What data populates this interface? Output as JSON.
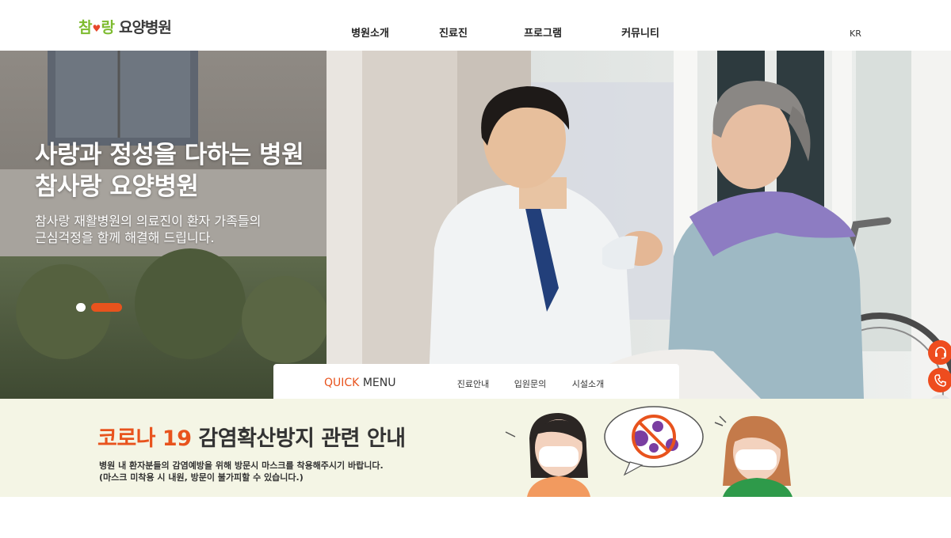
{
  "header": {
    "logo_part1": "참",
    "logo_part2": "랑",
    "logo_part3": "요양병원",
    "nav": [
      "병원소개",
      "진료진",
      "프로그램",
      "커뮤니티"
    ],
    "lang": "KR"
  },
  "hero": {
    "title_line1": "사랑과 정성을 다하는 병원",
    "title_line2": "참사랑 요양병원",
    "sub_line1": "참사랑 재활병원의 의료진이 환자 가족들의",
    "sub_line2": "근심걱정을 함께 해결해 드립니다."
  },
  "quick": {
    "title_accent": "QUICK",
    "title_rest": "MENU",
    "links": [
      "진료안내",
      "입원문의",
      "시설소개"
    ]
  },
  "banner": {
    "title_accent": "코로나 19",
    "title_rest": "감염확산방지 관련 안내",
    "line1": "병원 내 환자분들의 감염예방을 위해 방문시 마스크를 착용해주시기 바랍니다.",
    "line2": "(마스크 미착용 시 내원, 방문이 불가피할 수 있습니다.)"
  },
  "side": {
    "icons": [
      "headset-icon",
      "phone-icon",
      "chevron-up-icon"
    ]
  },
  "colors": {
    "accent": "#e8531d",
    "logo_green": "#7dbb2f",
    "banner_bg": "#f4f5e5"
  }
}
